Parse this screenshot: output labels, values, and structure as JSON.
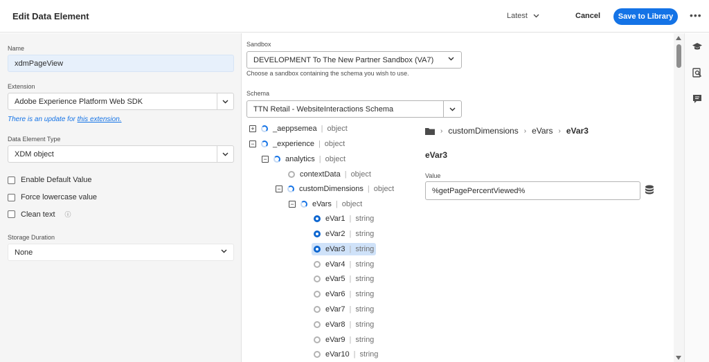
{
  "header": {
    "title": "Edit Data Element",
    "revision": "Latest",
    "cancel_label": "Cancel",
    "save_label": "Save to Library"
  },
  "left": {
    "name_label": "Name",
    "name_value": "xdmPageView",
    "extension_label": "Extension",
    "extension_value": "Adobe Experience Platform Web SDK",
    "update_prefix": "There is an update for",
    "update_link": "this extension.",
    "type_label": "Data Element Type",
    "type_value": "XDM object",
    "checkboxes": [
      "Enable Default Value",
      "Force lowercase value",
      "Clean text"
    ],
    "storage_label": "Storage Duration",
    "storage_value": "None"
  },
  "sandbox": {
    "label": "Sandbox",
    "value": "DEVELOPMENT To The New Partner Sandbox (VA7)",
    "help": "Choose a sandbox containing the schema you wish to use."
  },
  "schema": {
    "label": "Schema",
    "value": "TTN Retail - WebsiteInteractions Schema"
  },
  "tree": [
    {
      "name": "_aeppsemea",
      "type": "object"
    },
    {
      "name": "_experience",
      "type": "object"
    },
    {
      "name": "analytics",
      "type": "object"
    },
    {
      "name": "contextData",
      "type": "object"
    },
    {
      "name": "customDimensions",
      "type": "object"
    },
    {
      "name": "eVars",
      "type": "object"
    },
    {
      "name": "eVar1",
      "type": "string"
    },
    {
      "name": "eVar2",
      "type": "string"
    },
    {
      "name": "eVar3",
      "type": "string"
    },
    {
      "name": "eVar4",
      "type": "string"
    },
    {
      "name": "eVar5",
      "type": "string"
    },
    {
      "name": "eVar6",
      "type": "string"
    },
    {
      "name": "eVar7",
      "type": "string"
    },
    {
      "name": "eVar8",
      "type": "string"
    },
    {
      "name": "eVar9",
      "type": "string"
    },
    {
      "name": "eVar10",
      "type": "string"
    }
  ],
  "detail": {
    "breadcrumb": [
      "customDimensions",
      "eVars",
      "eVar3"
    ],
    "title": "eVar3",
    "value_label": "Value",
    "value": "%getPagePercentViewed%"
  }
}
